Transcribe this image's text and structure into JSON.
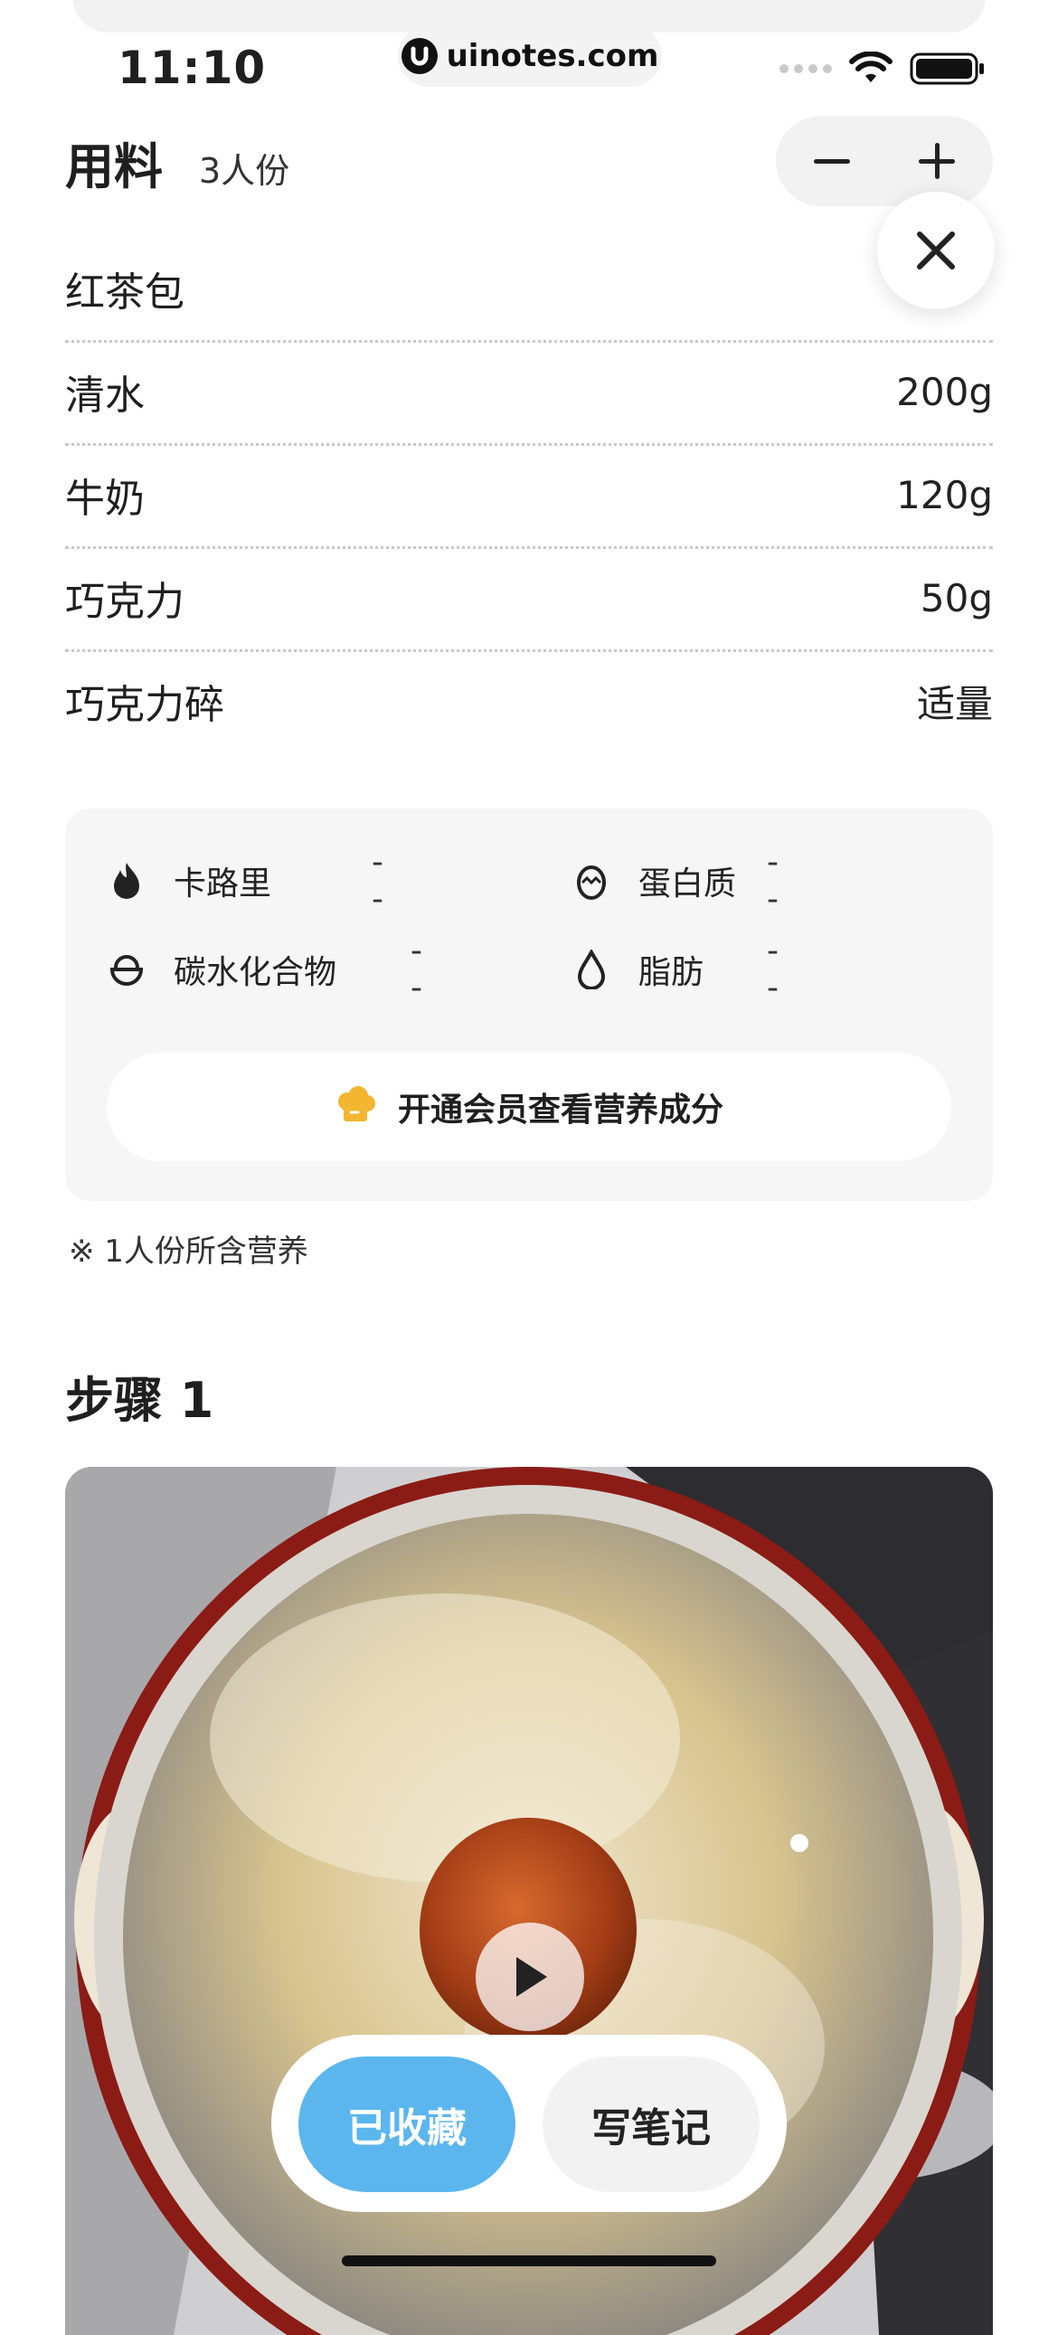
{
  "status_bar": {
    "time": "11:10",
    "url": "uinotes.com"
  },
  "ingredients": {
    "title": "用料",
    "servings": "3人份",
    "items": [
      {
        "name": "红茶包",
        "amount": ""
      },
      {
        "name": "清水",
        "amount": "200g"
      },
      {
        "name": "牛奶",
        "amount": "120g"
      },
      {
        "name": "巧克力",
        "amount": "50g"
      },
      {
        "name": "巧克力碎",
        "amount": "适量"
      }
    ]
  },
  "nutrition": {
    "items": [
      {
        "label": "卡路里",
        "value": "--",
        "icon": "flame-icon"
      },
      {
        "label": "蛋白质",
        "value": "--",
        "icon": "egg-icon"
      },
      {
        "label": "碳水化合物",
        "value": "--",
        "icon": "bowl-icon"
      },
      {
        "label": "脂肪",
        "value": "--",
        "icon": "drop-icon"
      }
    ],
    "vip_button": "开通会员查看营养成分",
    "note": "※ 1人份所含营养"
  },
  "step": {
    "title": "步骤 1"
  },
  "actions": {
    "favorite": "已收藏",
    "write_note": "写笔记"
  },
  "colors": {
    "accent_blue": "#5bb6ee",
    "chef_yellow": "#f2b630"
  }
}
